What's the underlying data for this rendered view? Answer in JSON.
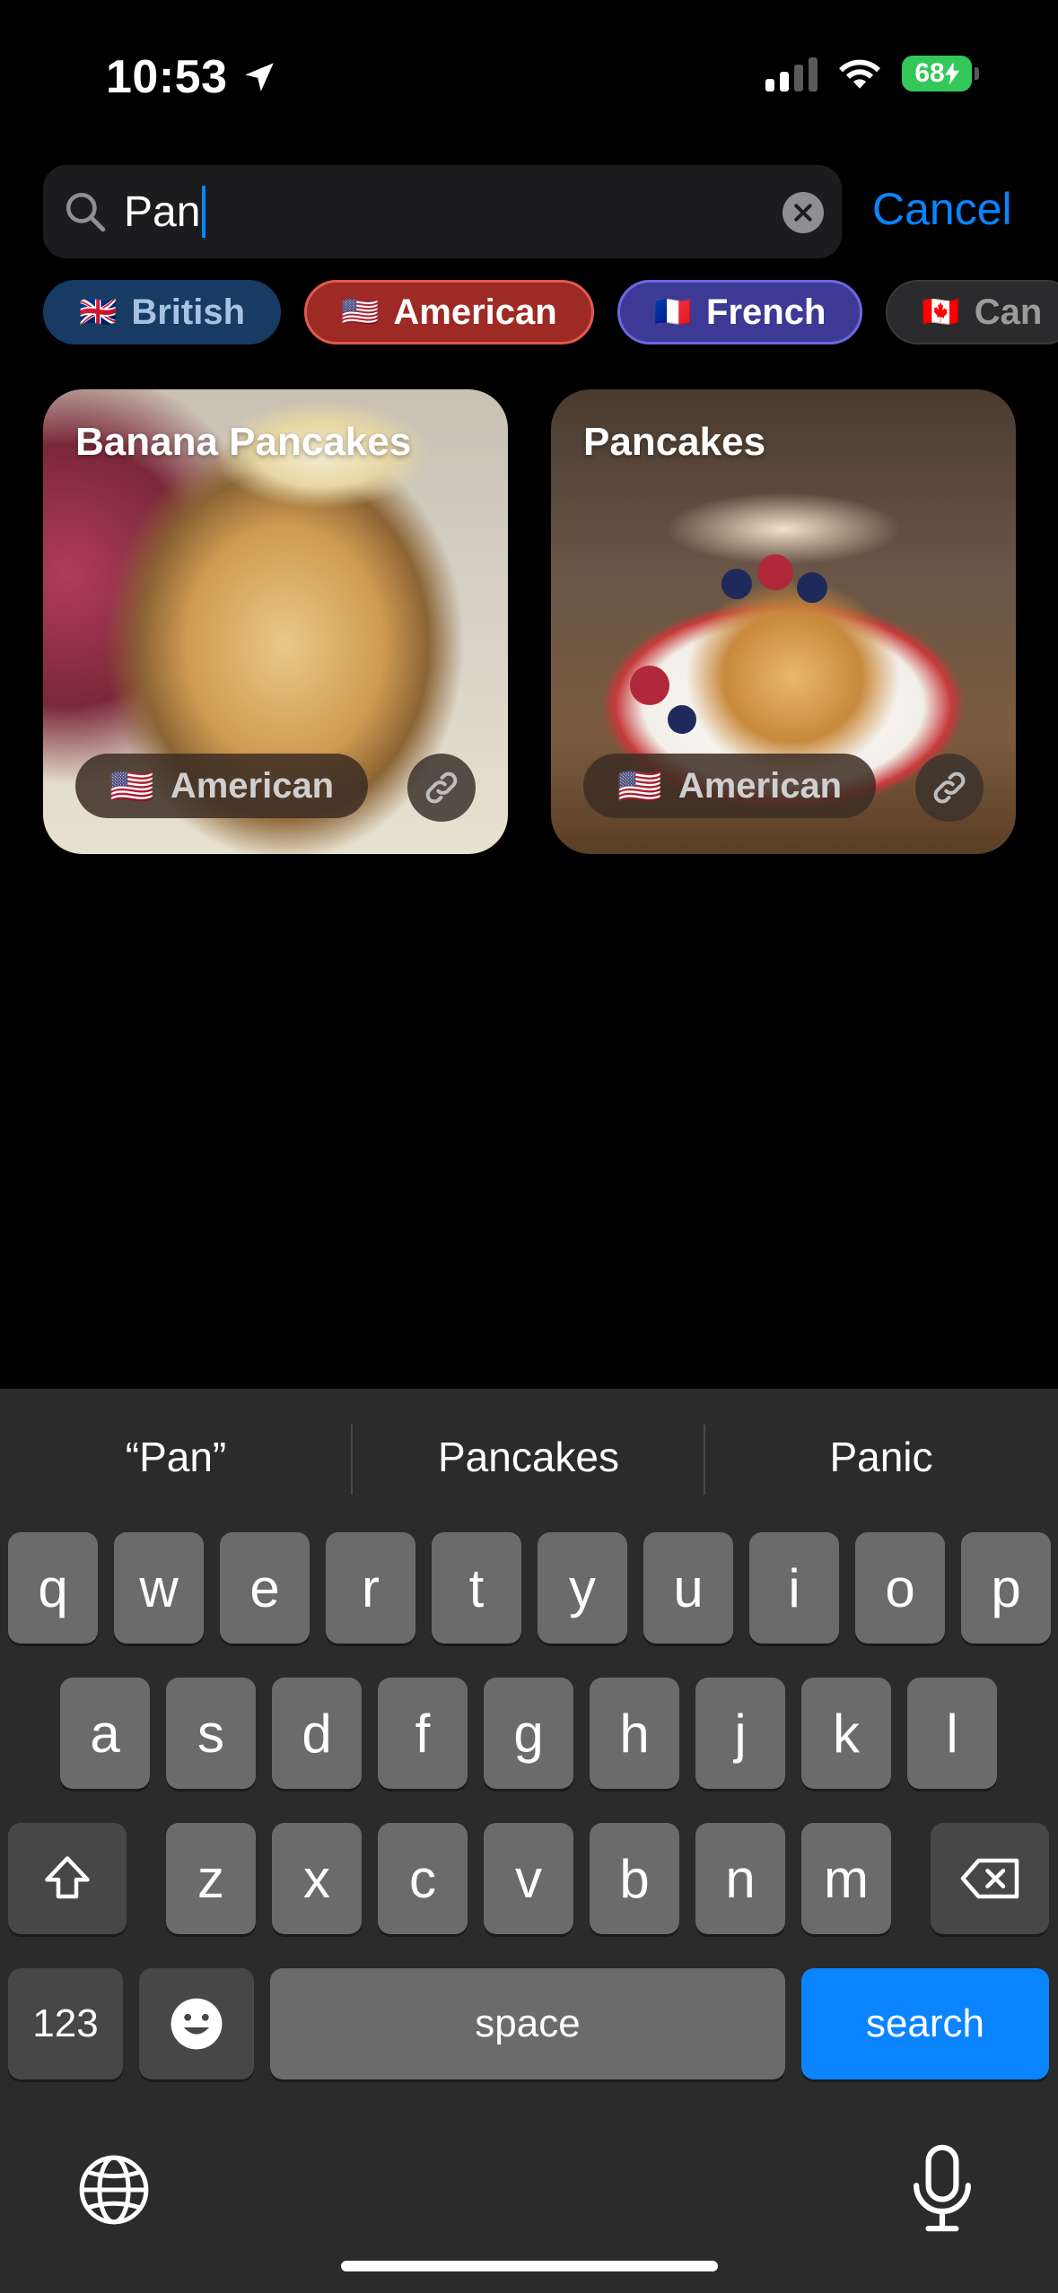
{
  "status_bar": {
    "time": "10:53",
    "battery": "68"
  },
  "search": {
    "query": "Pan",
    "cancel_label": "Cancel"
  },
  "chips": [
    {
      "flag": "🇬🇧",
      "label": "British"
    },
    {
      "flag": "🇺🇸",
      "label": "American"
    },
    {
      "flag": "🇫🇷",
      "label": "French"
    },
    {
      "flag": "🇨🇦",
      "label": "Can"
    }
  ],
  "results": [
    {
      "title": "Banana Pancakes",
      "cuisine_flag": "🇺🇸",
      "cuisine": "American"
    },
    {
      "title": "Pancakes",
      "cuisine_flag": "🇺🇸",
      "cuisine": "American"
    }
  ],
  "keyboard": {
    "suggestions": [
      "“Pan”",
      "Pancakes",
      "Panic"
    ],
    "row1": [
      "q",
      "w",
      "e",
      "r",
      "t",
      "y",
      "u",
      "i",
      "o",
      "p"
    ],
    "row2": [
      "a",
      "s",
      "d",
      "f",
      "g",
      "h",
      "j",
      "k",
      "l"
    ],
    "row3": [
      "z",
      "x",
      "c",
      "v",
      "b",
      "n",
      "m"
    ],
    "numbers_label": "123",
    "space_label": "space",
    "search_label": "search"
  },
  "colors": {
    "accent": "#0a84ff",
    "battery": "#34c759"
  }
}
